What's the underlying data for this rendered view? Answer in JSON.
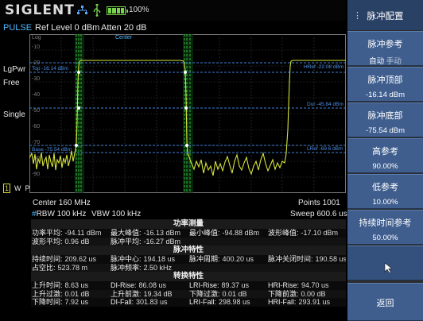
{
  "header": {
    "brand": "SIGLENT",
    "battery_text": "100%",
    "mode": "PULSE",
    "ref_level": "Ref Level  0 dBm",
    "atten": "Atten  20 dB"
  },
  "icons": {
    "network": "network-icon",
    "usb": "usb-icon",
    "battery": "battery-icon",
    "cursor": "cursor-arrow-icon"
  },
  "colors": {
    "trace": "#d6e43a",
    "marker_lines": "#2fbf3a",
    "ref_lines": "#3f80d8",
    "accent": "#4db8ff",
    "menu_button": "#3f5e8e",
    "menu_title": "#2a4166"
  },
  "left_labels": {
    "lgpwr": "LgPwr",
    "free": "Free",
    "single": "Single",
    "w": "W",
    "p": "P"
  },
  "graph": {
    "scale_label": "Log",
    "center_label": "Center",
    "y_ticks": [
      "-10",
      "-20",
      "-30",
      "-40",
      "-50",
      "-60",
      "-70",
      "-80",
      "-90"
    ],
    "top_label": "Top -16.14 dBm",
    "base_label": "Base -75.54 dBm",
    "href_label": "HRef -22.08 dBm",
    "dur_label": "Dur -45.84 dBm",
    "lref_label": "LRef -69.6 dBm"
  },
  "axis": {
    "center": "Center  160 MHz",
    "points": "Points  1001",
    "rbw_mark": "#",
    "rbw": "RBW  100 kHz",
    "vbw": "VBW  100 kHz",
    "sweep": "Sweep  600.6 us"
  },
  "table": {
    "sections": [
      {
        "title": "功率测量",
        "rows": [
          [
            {
              "label": "功率平均",
              "value": "-94.11 dBm"
            },
            {
              "label": "最大峰值",
              "value": "-16.13 dBm"
            },
            {
              "label": "最小峰值",
              "value": "-94.88 dBm"
            },
            {
              "label": "波形峰值",
              "value": "-17.10 dBm"
            }
          ],
          [
            {
              "label": "波形平均",
              "value": "0.96 dB"
            },
            {
              "label": "脉冲平均",
              "value": "-16.27 dBm"
            },
            {
              "label": "",
              "value": ""
            },
            {
              "label": "",
              "value": ""
            }
          ]
        ]
      },
      {
        "title": "脉冲特性",
        "rows": [
          [
            {
              "label": "持续时间",
              "value": "209.62 us"
            },
            {
              "label": "脉冲中心",
              "value": "194.18 us"
            },
            {
              "label": "脉冲周期",
              "value": "400.20 us"
            },
            {
              "label": "脉冲关闭时间",
              "value": "190.58 us"
            }
          ],
          [
            {
              "label": "占空比",
              "value": "523.78 m"
            },
            {
              "label": "脉冲频率",
              "value": "2.50 kHz"
            },
            {
              "label": "",
              "value": ""
            },
            {
              "label": "",
              "value": ""
            }
          ]
        ]
      },
      {
        "title": "转换特性",
        "rows": [
          [
            {
              "label": "上升时间",
              "value": "8.63 us"
            },
            {
              "label": "DI-Rise",
              "value": "86.08 us"
            },
            {
              "label": "LRI-Rise",
              "value": "89.37 us"
            },
            {
              "label": "HRI-Rise",
              "value": "94.70 us"
            }
          ],
          [
            {
              "label": "上升过激",
              "value": "0.01 dB"
            },
            {
              "label": "上升前激",
              "value": "19.34 dB"
            },
            {
              "label": "下降过激",
              "value": "0.01 dB"
            },
            {
              "label": "下降前激",
              "value": "0.00 dB"
            }
          ],
          [
            {
              "label": "下降时间",
              "value": "7.92 us"
            },
            {
              "label": "DI-Fall",
              "value": "301.83 us"
            },
            {
              "label": "LRI-Fall",
              "value": "298.98 us"
            },
            {
              "label": "HRI-Fall",
              "value": "293.91 us"
            }
          ]
        ]
      }
    ]
  },
  "menu": {
    "title_dots": "⋮",
    "title": "脉冲配置",
    "buttons": [
      {
        "label": "脉冲参考",
        "value_a": "自动",
        "value_b": "手动"
      },
      {
        "label": "脉冲顶部",
        "value": "-16.14 dBm"
      },
      {
        "label": "脉冲底部",
        "value": "-75.54 dBm"
      },
      {
        "label": "高参考",
        "value": "90.00%"
      },
      {
        "label": "低参考",
        "value": "10.00%"
      },
      {
        "label": "持续时间参考",
        "value": "50.00%"
      },
      {
        "label": "返回"
      }
    ]
  }
}
